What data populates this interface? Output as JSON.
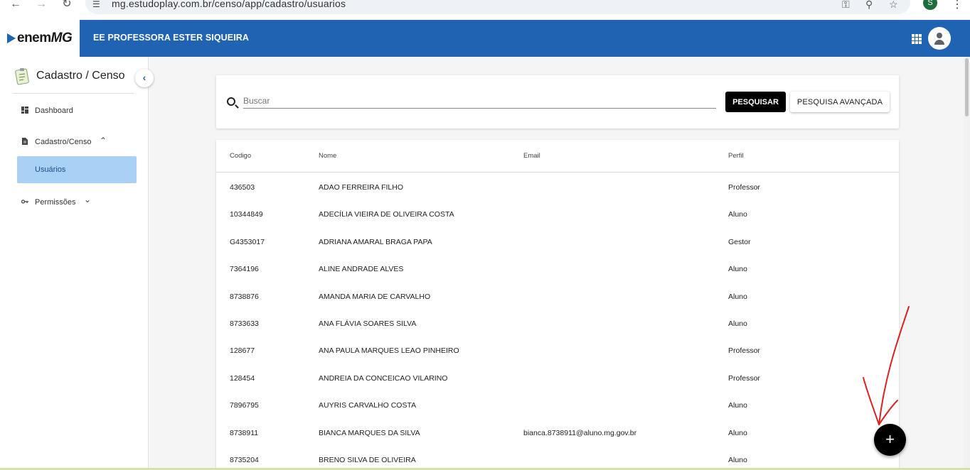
{
  "browser": {
    "url": "mg.estudoplay.com.br/censo/app/cadastro/usuarios",
    "profile_initial": "S"
  },
  "header": {
    "logo_enem": "enem",
    "logo_mg": "MG",
    "school_name": "EE PROFESSORA ESTER SIQUEIRA"
  },
  "sidebar": {
    "title": "Cadastro / Censo",
    "items": [
      {
        "label": "Dashboard"
      },
      {
        "label": "Cadastro/Censo"
      },
      {
        "label": "Usuários"
      },
      {
        "label": "Permissões"
      }
    ]
  },
  "search": {
    "placeholder": "Buscar",
    "search_label": "PESQUISAR",
    "advanced_label": "PESQUISA AVANÇADA"
  },
  "table": {
    "columns": [
      "Codigo",
      "Nome",
      "Email",
      "Perfil"
    ],
    "rows": [
      {
        "codigo": "436503",
        "nome": "ADAO FERREIRA FILHO",
        "email": "",
        "perfil": "Professor"
      },
      {
        "codigo": "10344849",
        "nome": "ADECÍLIA VIEIRA DE OLIVEIRA COSTA",
        "email": "",
        "perfil": "Aluno"
      },
      {
        "codigo": "G4353017",
        "nome": "ADRIANA AMARAL BRAGA PAPA",
        "email": "",
        "perfil": "Gestor"
      },
      {
        "codigo": "7364196",
        "nome": "ALINE ANDRADE ALVES",
        "email": "",
        "perfil": "Aluno"
      },
      {
        "codigo": "8738876",
        "nome": "AMANDA MARIA DE CARVALHO",
        "email": "",
        "perfil": "Aluno"
      },
      {
        "codigo": "8733633",
        "nome": "ANA FLÁVIA SOARES SILVA",
        "email": "",
        "perfil": "Aluno"
      },
      {
        "codigo": "128677",
        "nome": "ANA PAULA MARQUES LEAO PINHEIRO",
        "email": "",
        "perfil": "Professor"
      },
      {
        "codigo": "128454",
        "nome": "ANDREIA DA CONCEICAO VILARINO",
        "email": "",
        "perfil": "Professor"
      },
      {
        "codigo": "7896795",
        "nome": "AUYRIS CARVALHO COSTA",
        "email": "",
        "perfil": "Aluno"
      },
      {
        "codigo": "8738911",
        "nome": "BIANCA MARQUES DA SILVA",
        "email": "bianca.8738911@aluno.mg.gov.br",
        "perfil": "Aluno"
      },
      {
        "codigo": "8735204",
        "nome": "BRENO SILVA DE OLIVEIRA",
        "email": "",
        "perfil": "Aluno"
      }
    ]
  },
  "fab": {
    "label": "+"
  },
  "colors": {
    "header_blue": "#1f63b2",
    "active_item": "#a9d0f5",
    "annotation_red": "#e02020"
  }
}
